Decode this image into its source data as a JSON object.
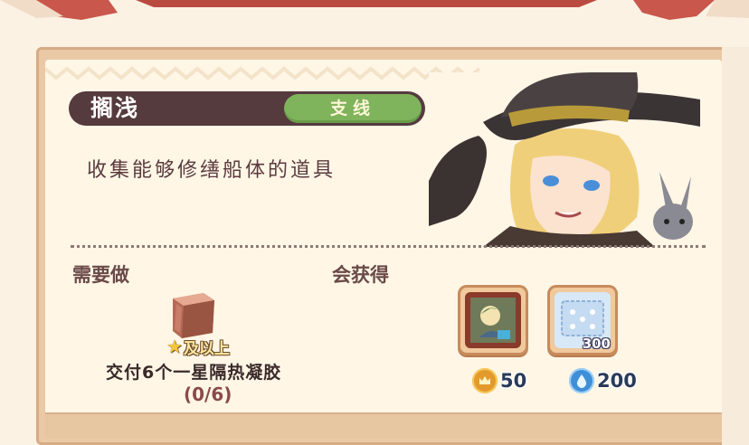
{
  "quest": {
    "title": "搁浅",
    "tag": "支线",
    "description": "收集能够修缮船体的道具"
  },
  "sections": {
    "todo_label": "需要做",
    "reward_label": "会获得"
  },
  "task": {
    "item_icon": "brown-cube-icon",
    "star_level": "★",
    "level_text": "及以上",
    "text": "交付6个一星隔热凝胶",
    "progress": "(0/6)",
    "done": 0,
    "total": 6
  },
  "rewards": {
    "items": [
      {
        "icon": "portrait-painting-icon"
      },
      {
        "icon": "blue-fabric-icon",
        "quantity": "300"
      }
    ],
    "currencies": [
      {
        "icon": "gold-crown-coin-icon",
        "value": "50"
      },
      {
        "icon": "blue-drop-coin-icon",
        "value": "200"
      }
    ]
  },
  "colors": {
    "title_bar": "#553a3e",
    "tag_green": "#7fb35c",
    "card_bg": "#fff6e6",
    "frame": "#e9c9a6"
  }
}
